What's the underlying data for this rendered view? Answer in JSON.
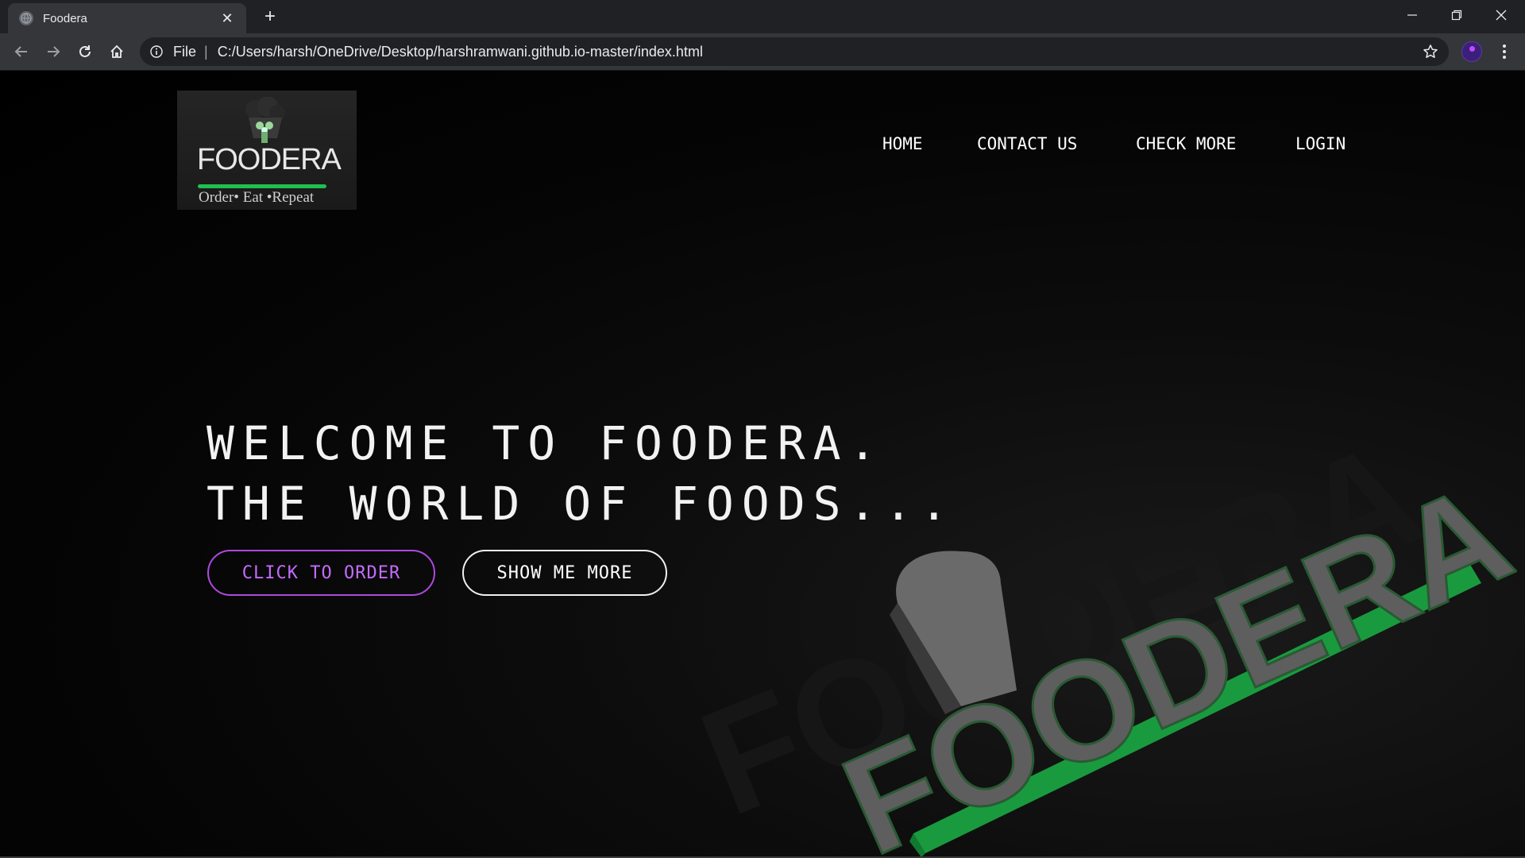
{
  "browser": {
    "tab_title": "Foodera",
    "tab_close": "✕",
    "new_tab": "+",
    "url_scheme": "File",
    "url_separator": "|",
    "url": "C:/Users/harsh/OneDrive/Desktop/harshramwani.github.io-master/index.html",
    "icons": [
      "globe-icon",
      "close-icon",
      "plus-icon",
      "minimize-icon",
      "maximize-icon",
      "window-close-icon",
      "back-arrow-icon",
      "forward-arrow-icon",
      "reload-icon",
      "home-icon",
      "info-icon",
      "star-icon",
      "avatar",
      "kebab-menu-icon"
    ]
  },
  "site": {
    "logo": {
      "wordmark": "FOODERA",
      "tagline": "Order• Eat •Repeat",
      "bar_color": "#1fbf4f"
    },
    "nav": {
      "home": "HOME",
      "contact": "CONTACT US",
      "check_more": "CHECK MORE",
      "login": "LOGIN"
    },
    "hero": {
      "line1": "WELCOME TO FOODERA.",
      "line2": "THE WORLD OF FOODS...",
      "order_button": "CLICK TO ORDER",
      "more_button": "SHOW ME MORE",
      "accent_color": "#b048e0"
    },
    "hero_art": {
      "wordmark": "FOODERA",
      "bar_color": "#1a9a3e"
    }
  }
}
